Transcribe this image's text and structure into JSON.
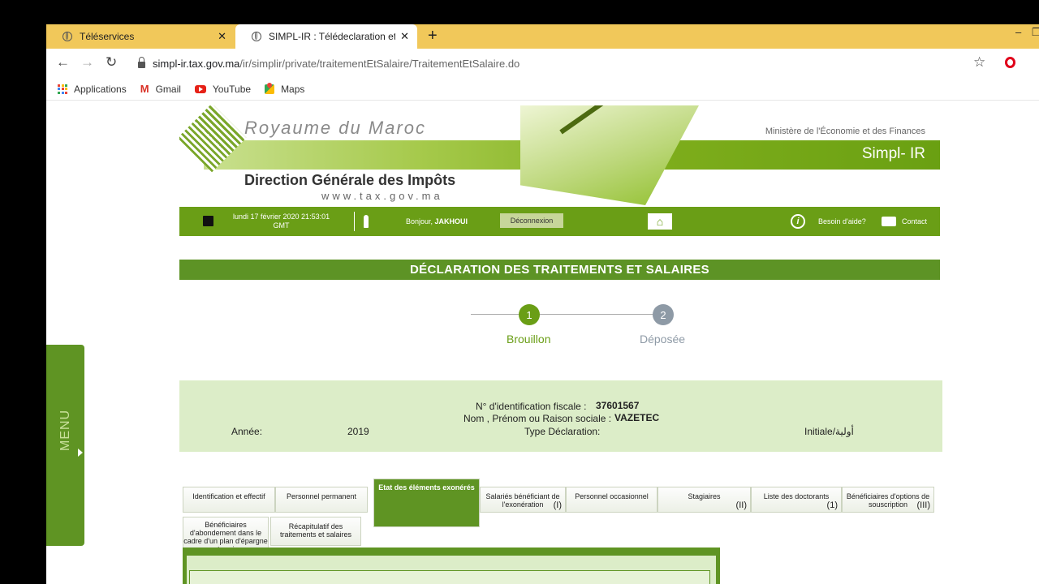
{
  "browser": {
    "tabs": [
      {
        "label": "Téléservices",
        "active": false
      },
      {
        "label": "SIMPL-IR : Télédeclaration et Télé",
        "active": true
      }
    ],
    "new_tab_label": "+",
    "url_host": "simpl-ir.tax.gov.ma",
    "url_path": "/ir/simplir/private/traitementEtSalaire/TraitementEtSalaire.do",
    "bookmarks": [
      {
        "label": "Applications",
        "icon": "apps-grid-icon"
      },
      {
        "label": "Gmail",
        "icon": "gmail-icon"
      },
      {
        "label": "YouTube",
        "icon": "youtube-icon"
      },
      {
        "label": "Maps",
        "icon": "maps-icon"
      }
    ]
  },
  "banner": {
    "royaume": "Royaume du Maroc",
    "ministere": "Ministère de l'Économie et des Finances",
    "product": "Simpl- IR",
    "direction": "Direction Générale des Impôts",
    "website": "www.tax.gov.ma"
  },
  "userbar": {
    "datetime_line1": "lundi 17 février 2020 21:53:01",
    "datetime_line2": "GMT",
    "greeting": "Bonjour,",
    "username": "JAKHOUI",
    "logout": "Déconnexion",
    "help": "Besoin d'aide?",
    "contact": "Contact"
  },
  "page_title": "DÉCLARATION DES TRAITEMENTS ET SALAIRES",
  "steps": [
    {
      "num": "1",
      "label": "Brouillon",
      "color": "#6a9e16"
    },
    {
      "num": "2",
      "label": "Déposée",
      "color": "#8e9aa6"
    }
  ],
  "info": {
    "nif_label": "N° d'identification fiscale   :",
    "nif_value": "37601567",
    "name_label": "Nom , Prénom ou Raison sociale   :",
    "name_value": "VAZETEC",
    "year_label": "Année:",
    "year_value": "2019",
    "type_label": "Type Déclaration:",
    "type_value": "Initiale/أولية"
  },
  "menu_label": "MENU",
  "form_tabs": [
    {
      "label": "Identification et effectif",
      "num": ""
    },
    {
      "label": "Personnel permanent",
      "num": ""
    },
    {
      "label": "Etat des éléments exonérés",
      "num": ""
    },
    {
      "label": "Salariés bénéficiant de l'exonération",
      "num": "(I)"
    },
    {
      "label": "Personnel occasionnel",
      "num": ""
    },
    {
      "label": "Stagiaires",
      "num": "(II)"
    },
    {
      "label": "Liste des doctorants",
      "num": "(1)"
    },
    {
      "label": "Bénéficiaires d'options de souscription",
      "num": "(III)"
    },
    {
      "label": "Bénéficiaires d'abondement dans le cadre d'un plan d'épargne entreprise",
      "num": ""
    },
    {
      "label": "Récapitulatif des traitements et salaires",
      "num": ""
    }
  ],
  "colors": {
    "brand_green": "#5f9423",
    "light_green": "#dcedc8",
    "tab_strip": "#f1c85a"
  }
}
